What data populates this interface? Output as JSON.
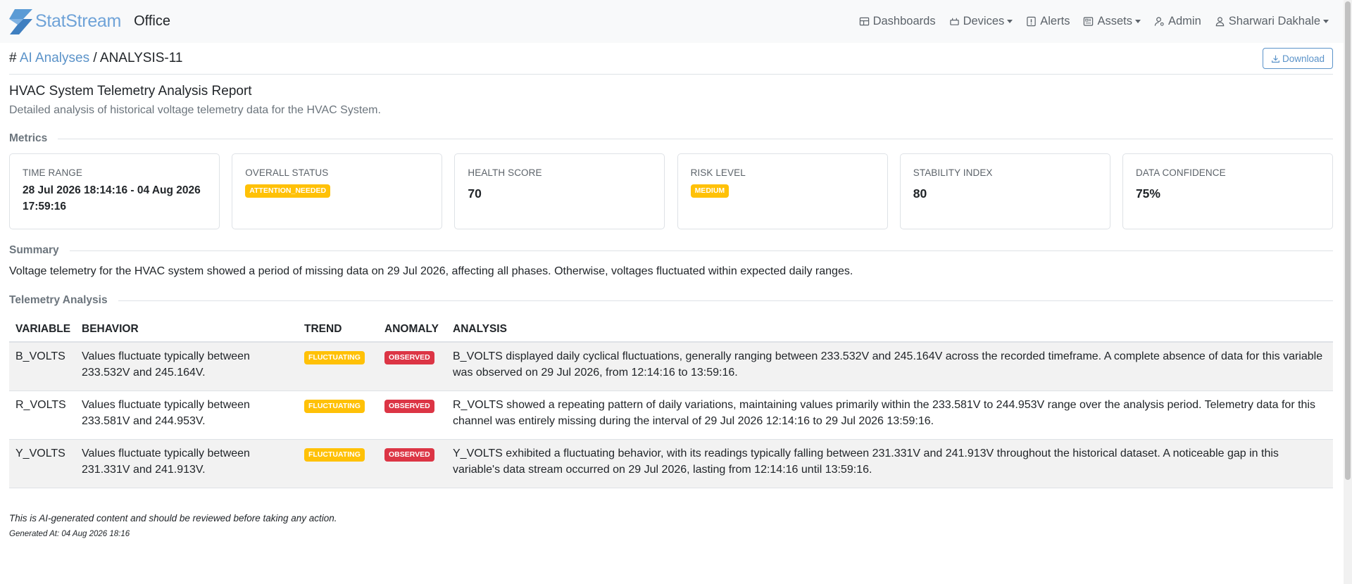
{
  "nav": {
    "brand": "StatStream",
    "app": "Office",
    "items": [
      {
        "label": "Dashboards",
        "icon": "dashboard-icon",
        "dropdown": false
      },
      {
        "label": "Devices",
        "icon": "devices-icon",
        "dropdown": true
      },
      {
        "label": "Alerts",
        "icon": "alert-icon",
        "dropdown": false
      },
      {
        "label": "Assets",
        "icon": "assets-icon",
        "dropdown": true
      },
      {
        "label": "Admin",
        "icon": "admin-icon",
        "dropdown": false
      },
      {
        "label": "Sharwari Dakhale",
        "icon": "user-icon",
        "dropdown": true
      }
    ]
  },
  "breadcrumb": {
    "prefix": "#",
    "parent": "AI Analyses",
    "separator": "/",
    "current": "ANALYSIS-11"
  },
  "download_label": "Download",
  "report": {
    "title": "HVAC System Telemetry Analysis Report",
    "subtitle": "Detailed analysis of historical voltage telemetry data for the HVAC System."
  },
  "sections": {
    "metrics": "Metrics",
    "summary": "Summary",
    "telemetry": "Telemetry Analysis"
  },
  "metrics": {
    "time_range": {
      "label": "TIME RANGE",
      "value": "28 Jul 2026 18:14:16 - 04 Aug 2026 17:59:16"
    },
    "overall_status": {
      "label": "OVERALL STATUS",
      "value": "ATTENTION_NEEDED"
    },
    "health_score": {
      "label": "HEALTH SCORE",
      "value": "70"
    },
    "risk_level": {
      "label": "RISK LEVEL",
      "value": "MEDIUM"
    },
    "stability_index": {
      "label": "STABILITY INDEX",
      "value": "80"
    },
    "data_confidence": {
      "label": "DATA CONFIDENCE",
      "value": "75%"
    }
  },
  "summary": "Voltage telemetry for the HVAC system showed a period of missing data on 29 Jul 2026, affecting all phases. Otherwise, voltages fluctuated within expected daily ranges.",
  "table": {
    "headers": {
      "variable": "VARIABLE",
      "behavior": "BEHAVIOR",
      "trend": "TREND",
      "anomaly": "ANOMALY",
      "analysis": "ANALYSIS"
    },
    "rows": [
      {
        "variable": "B_VOLTS",
        "behavior": "Values fluctuate typically between 233.532V and 245.164V.",
        "trend": "FLUCTUATING",
        "anomaly": "OBSERVED",
        "analysis": "B_VOLTS displayed daily cyclical fluctuations, generally ranging between 233.532V and 245.164V across the recorded timeframe. A complete absence of data for this variable was observed on 29 Jul 2026, from 12:14:16 to 13:59:16."
      },
      {
        "variable": "R_VOLTS",
        "behavior": "Values fluctuate typically between 233.581V and 244.953V.",
        "trend": "FLUCTUATING",
        "anomaly": "OBSERVED",
        "analysis": "R_VOLTS showed a repeating pattern of daily variations, maintaining values primarily within the 233.581V to 244.953V range over the analysis period. Telemetry data for this channel was entirely missing during the interval of 29 Jul 2026 12:14:16 to 29 Jul 2026 13:59:16."
      },
      {
        "variable": "Y_VOLTS",
        "behavior": "Values fluctuate typically between 231.331V and 241.913V.",
        "trend": "FLUCTUATING",
        "anomaly": "OBSERVED",
        "analysis": "Y_VOLTS exhibited a fluctuating behavior, with its readings typically falling between 231.331V and 241.913V throughout the historical dataset. A noticeable gap in this variable's data stream occurred on 29 Jul 2026, lasting from 12:14:16 until 13:59:16."
      }
    ]
  },
  "disclaimer": "This is AI-generated content and should be reviewed before taking any action.",
  "generated_at": "Generated At: 04 Aug 2026 18:16",
  "colors": {
    "brand": "#6fa3d8",
    "link": "#5b93c9",
    "warning": "#ffc107",
    "danger": "#dc3545"
  }
}
